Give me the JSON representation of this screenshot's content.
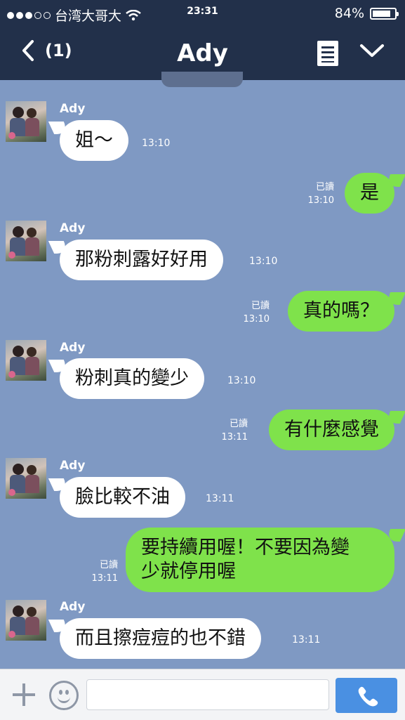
{
  "status": {
    "carrier": "台湾大哥大",
    "time": "23:31",
    "battery": "84%",
    "battery_level": 0.84,
    "signal_dots_filled": 3,
    "signal_dots_total": 5
  },
  "header": {
    "unread": "(1)",
    "title": "Ady"
  },
  "icons": {
    "back": "chevron-left-icon",
    "notes": "notes-icon",
    "menu": "chevron-down-icon",
    "add": "plus-icon",
    "sticker": "smiley-icon",
    "call": "phone-icon"
  },
  "colors": {
    "header_bg": "#22304a",
    "outgoing_bubble": "#7fe24b",
    "incoming_bubble": "#ffffff",
    "call_button": "#4a90e2"
  },
  "messages": [
    {
      "side": "in",
      "sender": "Ady",
      "text": "姐～",
      "time": "13:10"
    },
    {
      "side": "out",
      "text": "是",
      "status": "已讀",
      "time": "13:10"
    },
    {
      "side": "in",
      "sender": "Ady",
      "text": "那粉刺露好好用",
      "time": "13:10"
    },
    {
      "side": "out",
      "text": "真的嗎？",
      "status": "已讀",
      "time": "13:10"
    },
    {
      "side": "in",
      "sender": "Ady",
      "text": "粉刺真的變少",
      "time": "13:10"
    },
    {
      "side": "out",
      "text": "有什麼感覺",
      "status": "已讀",
      "time": "13:11"
    },
    {
      "side": "in",
      "sender": "Ady",
      "text": "臉比較不油",
      "time": "13:11"
    },
    {
      "side": "out",
      "lines": [
        "要持續用喔！不要因為變",
        "少就停用喔"
      ],
      "status": "已讀",
      "time": "13:11"
    },
    {
      "side": "in",
      "sender": "Ady",
      "text": "而且擦痘痘的也不錯",
      "time": "13:11"
    }
  ],
  "input": {
    "value": ""
  }
}
